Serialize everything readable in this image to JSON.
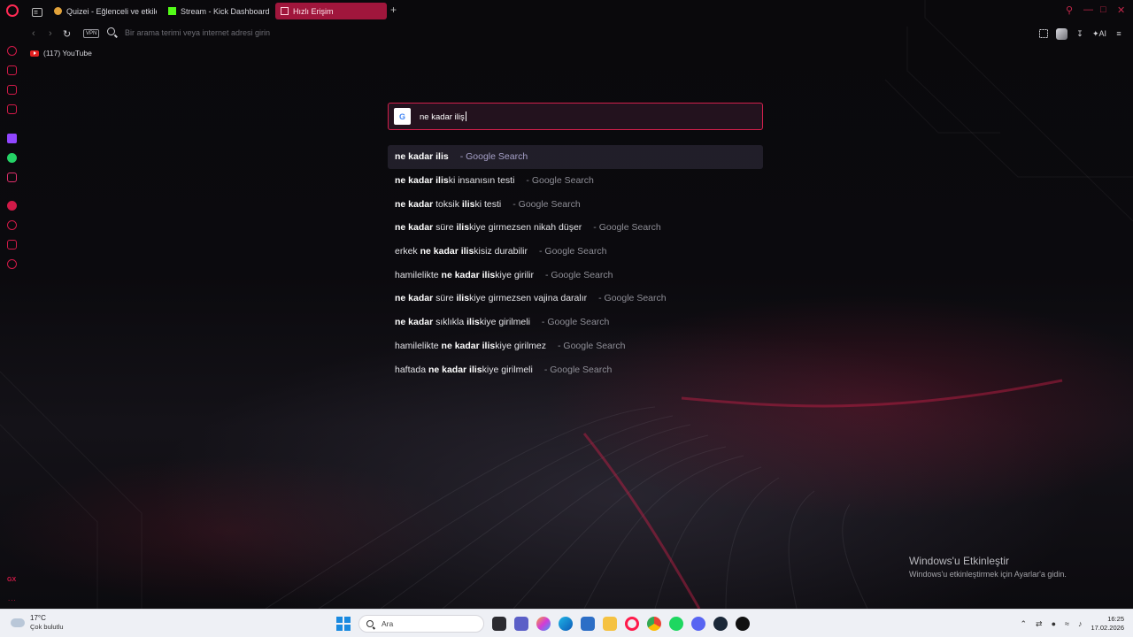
{
  "tabs": [
    {
      "label": "Quizei - Eğlenceli ve etkile",
      "active": false
    },
    {
      "label": "Stream - Kick Dashboard",
      "active": false
    },
    {
      "label": "Hızlı Erişim",
      "active": true
    }
  ],
  "new_tab_label": "+",
  "address_bar": {
    "vpn_label": "VPN",
    "placeholder": "Bir arama terimi veya internet adresi girin",
    "ai_label": "AI"
  },
  "bookmarks": [
    {
      "label": "(117) YouTube",
      "icon": "youtube-icon"
    }
  ],
  "search": {
    "engine_badge": "G",
    "query": "ne kadar iliş"
  },
  "suggestions": [
    {
      "parts": [
        {
          "t": "ne kadar ilis",
          "b": true
        }
      ],
      "source": "- Google Search"
    },
    {
      "parts": [
        {
          "t": "ne kadar ilis",
          "b": true
        },
        {
          "t": "ki insanısın testi",
          "b": false
        }
      ],
      "source": "- Google Search"
    },
    {
      "parts": [
        {
          "t": "ne kadar",
          "b": true
        },
        {
          "t": " toksik ",
          "b": false
        },
        {
          "t": "ilis",
          "b": true
        },
        {
          "t": "ki testi",
          "b": false
        }
      ],
      "source": "- Google Search"
    },
    {
      "parts": [
        {
          "t": "ne kadar",
          "b": true
        },
        {
          "t": " süre ",
          "b": false
        },
        {
          "t": "ilis",
          "b": true
        },
        {
          "t": "kiye girmezsen nikah düşer",
          "b": false
        }
      ],
      "source": "- Google Search"
    },
    {
      "parts": [
        {
          "t": "erkek ",
          "b": false
        },
        {
          "t": "ne kadar ilis",
          "b": true
        },
        {
          "t": "kisiz durabilir",
          "b": false
        }
      ],
      "source": "- Google Search"
    },
    {
      "parts": [
        {
          "t": "hamilelikte ",
          "b": false
        },
        {
          "t": "ne kadar ilis",
          "b": true
        },
        {
          "t": "kiye girilir",
          "b": false
        }
      ],
      "source": "- Google Search"
    },
    {
      "parts": [
        {
          "t": "ne kadar",
          "b": true
        },
        {
          "t": " süre ",
          "b": false
        },
        {
          "t": "ilis",
          "b": true
        },
        {
          "t": "kiye girmezsen vajina daralır",
          "b": false
        }
      ],
      "source": "- Google Search"
    },
    {
      "parts": [
        {
          "t": "ne kadar",
          "b": true
        },
        {
          "t": " sıklıkla ",
          "b": false
        },
        {
          "t": "ilis",
          "b": true
        },
        {
          "t": "kiye girilmeli",
          "b": false
        }
      ],
      "source": "- Google Search"
    },
    {
      "parts": [
        {
          "t": "hamilelikte ",
          "b": false
        },
        {
          "t": "ne kadar ilis",
          "b": true
        },
        {
          "t": "kiye girilmez",
          "b": false
        }
      ],
      "source": "- Google Search"
    },
    {
      "parts": [
        {
          "t": "haftada ",
          "b": false
        },
        {
          "t": "ne kadar ilis",
          "b": true
        },
        {
          "t": "kiye girilmeli",
          "b": false
        }
      ],
      "source": "- Google Search"
    }
  ],
  "activation": {
    "title": "Windows'u Etkinleştir",
    "subtitle": "Windows'u etkinleştirmek için Ayarlar'a gidin."
  },
  "sidebar": {
    "gx_label": "GX",
    "more_label": "..."
  },
  "taskbar": {
    "temperature": "17°C",
    "weather_condition": "Çok bulutlu",
    "search_placeholder": "Ara",
    "time": "16:25",
    "date": "17.02.2026"
  },
  "colors": {
    "accent": "#d2204c",
    "active_tab": "#a0163c"
  }
}
